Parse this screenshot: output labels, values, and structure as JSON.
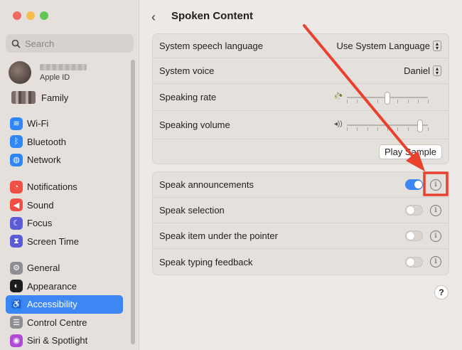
{
  "sidebar": {
    "search_placeholder": "Search",
    "profile_subtitle": "Apple ID",
    "family_label": "Family",
    "groups": [
      [
        {
          "label": "Wi-Fi",
          "icon": "wifi-icon",
          "color": "#2f86f6",
          "glyph": "≋"
        },
        {
          "label": "Bluetooth",
          "icon": "bluetooth-icon",
          "color": "#2f86f6",
          "glyph": "ᛒ"
        },
        {
          "label": "Network",
          "icon": "globe-icon",
          "color": "#2f86f6",
          "glyph": "◍"
        }
      ],
      [
        {
          "label": "Notifications",
          "icon": "bell-icon",
          "color": "#ef4f45",
          "glyph": "◔"
        },
        {
          "label": "Sound",
          "icon": "speaker-icon",
          "color": "#ef4f45",
          "glyph": "◀"
        },
        {
          "label": "Focus",
          "icon": "moon-icon",
          "color": "#5b5bd6",
          "glyph": "☾"
        },
        {
          "label": "Screen Time",
          "icon": "hourglass-icon",
          "color": "#5b5bd6",
          "glyph": "⧗"
        }
      ],
      [
        {
          "label": "General",
          "icon": "gear-icon",
          "color": "#8e8e93",
          "glyph": "⚙"
        },
        {
          "label": "Appearance",
          "icon": "appearance-icon",
          "color": "#1c1c1e",
          "glyph": "◐"
        },
        {
          "label": "Accessibility",
          "icon": "accessibility-icon",
          "color": "#2f86f6",
          "glyph": "♿",
          "active": true
        },
        {
          "label": "Control Centre",
          "icon": "control-centre-icon",
          "color": "#8e8e93",
          "glyph": "☰"
        },
        {
          "label": "Siri & Spotlight",
          "icon": "siri-icon",
          "color": "#b04ad6",
          "glyph": "◉"
        }
      ]
    ]
  },
  "main": {
    "title": "Spoken Content",
    "speech": {
      "language_label": "System speech language",
      "language_value": "Use System Language",
      "voice_label": "System voice",
      "voice_value": "Daniel",
      "rate_label": "Speaking rate",
      "rate_value": 0.5,
      "volume_label": "Speaking volume",
      "volume_value": 0.9,
      "play_sample": "Play Sample"
    },
    "options": [
      {
        "label": "Speak announcements",
        "on": true
      },
      {
        "label": "Speak selection",
        "on": false
      },
      {
        "label": "Speak item under the pointer",
        "on": false
      },
      {
        "label": "Speak typing feedback",
        "on": false
      }
    ],
    "help": "?"
  },
  "colors": {
    "accent": "#3d87f5",
    "annotation": "#e8412e"
  }
}
